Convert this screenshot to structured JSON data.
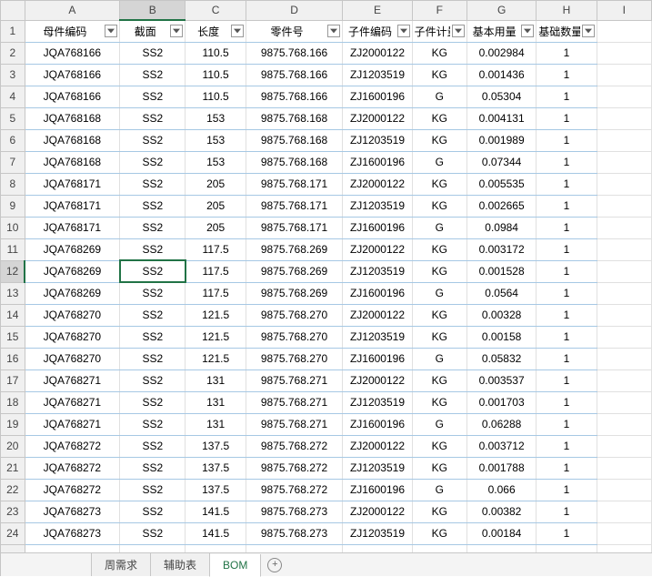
{
  "columns_letters": [
    "A",
    "B",
    "C",
    "D",
    "E",
    "F",
    "G",
    "H",
    "I"
  ],
  "selected_col_index": 1,
  "selected_row": 12,
  "selected_cell": {
    "row": 12,
    "col": 1
  },
  "filter_headers": [
    "母件编码",
    "截面",
    "长度",
    "零件号",
    "子件编码",
    "子件计量单位",
    "基本用量",
    "基础数量"
  ],
  "chart_data": {
    "type": "table",
    "columns": [
      "母件编码",
      "截面",
      "长度",
      "零件号",
      "子件编码",
      "子件计量单位",
      "基本用量",
      "基础数量"
    ],
    "data": [
      [
        "JQA768166",
        "SS2",
        "110.5",
        "9875.768.166",
        "ZJ2000122",
        "KG",
        "0.002984",
        "1"
      ],
      [
        "JQA768166",
        "SS2",
        "110.5",
        "9875.768.166",
        "ZJ1203519",
        "KG",
        "0.001436",
        "1"
      ],
      [
        "JQA768166",
        "SS2",
        "110.5",
        "9875.768.166",
        "ZJ1600196",
        "G",
        "0.05304",
        "1"
      ],
      [
        "JQA768168",
        "SS2",
        "153",
        "9875.768.168",
        "ZJ2000122",
        "KG",
        "0.004131",
        "1"
      ],
      [
        "JQA768168",
        "SS2",
        "153",
        "9875.768.168",
        "ZJ1203519",
        "KG",
        "0.001989",
        "1"
      ],
      [
        "JQA768168",
        "SS2",
        "153",
        "9875.768.168",
        "ZJ1600196",
        "G",
        "0.07344",
        "1"
      ],
      [
        "JQA768171",
        "SS2",
        "205",
        "9875.768.171",
        "ZJ2000122",
        "KG",
        "0.005535",
        "1"
      ],
      [
        "JQA768171",
        "SS2",
        "205",
        "9875.768.171",
        "ZJ1203519",
        "KG",
        "0.002665",
        "1"
      ],
      [
        "JQA768171",
        "SS2",
        "205",
        "9875.768.171",
        "ZJ1600196",
        "G",
        "0.0984",
        "1"
      ],
      [
        "JQA768269",
        "SS2",
        "117.5",
        "9875.768.269",
        "ZJ2000122",
        "KG",
        "0.003172",
        "1"
      ],
      [
        "JQA768269",
        "SS2",
        "117.5",
        "9875.768.269",
        "ZJ1203519",
        "KG",
        "0.001528",
        "1"
      ],
      [
        "JQA768269",
        "SS2",
        "117.5",
        "9875.768.269",
        "ZJ1600196",
        "G",
        "0.0564",
        "1"
      ],
      [
        "JQA768270",
        "SS2",
        "121.5",
        "9875.768.270",
        "ZJ2000122",
        "KG",
        "0.00328",
        "1"
      ],
      [
        "JQA768270",
        "SS2",
        "121.5",
        "9875.768.270",
        "ZJ1203519",
        "KG",
        "0.00158",
        "1"
      ],
      [
        "JQA768270",
        "SS2",
        "121.5",
        "9875.768.270",
        "ZJ1600196",
        "G",
        "0.05832",
        "1"
      ],
      [
        "JQA768271",
        "SS2",
        "131",
        "9875.768.271",
        "ZJ2000122",
        "KG",
        "0.003537",
        "1"
      ],
      [
        "JQA768271",
        "SS2",
        "131",
        "9875.768.271",
        "ZJ1203519",
        "KG",
        "0.001703",
        "1"
      ],
      [
        "JQA768271",
        "SS2",
        "131",
        "9875.768.271",
        "ZJ1600196",
        "G",
        "0.06288",
        "1"
      ],
      [
        "JQA768272",
        "SS2",
        "137.5",
        "9875.768.272",
        "ZJ2000122",
        "KG",
        "0.003712",
        "1"
      ],
      [
        "JQA768272",
        "SS2",
        "137.5",
        "9875.768.272",
        "ZJ1203519",
        "KG",
        "0.001788",
        "1"
      ],
      [
        "JQA768272",
        "SS2",
        "137.5",
        "9875.768.272",
        "ZJ1600196",
        "G",
        "0.066",
        "1"
      ],
      [
        "JQA768273",
        "SS2",
        "141.5",
        "9875.768.273",
        "ZJ2000122",
        "KG",
        "0.00382",
        "1"
      ],
      [
        "JQA768273",
        "SS2",
        "141.5",
        "9875.768.273",
        "ZJ1203519",
        "KG",
        "0.00184",
        "1"
      ]
    ]
  },
  "row_numbers": [
    1,
    2,
    3,
    4,
    5,
    6,
    7,
    8,
    9,
    10,
    11,
    12,
    13,
    14,
    15,
    16,
    17,
    18,
    19,
    20,
    21,
    22,
    23,
    24
  ],
  "tabs": [
    {
      "label": "周需求",
      "active": false
    },
    {
      "label": "辅助表",
      "active": false
    },
    {
      "label": "BOM",
      "active": true
    }
  ]
}
